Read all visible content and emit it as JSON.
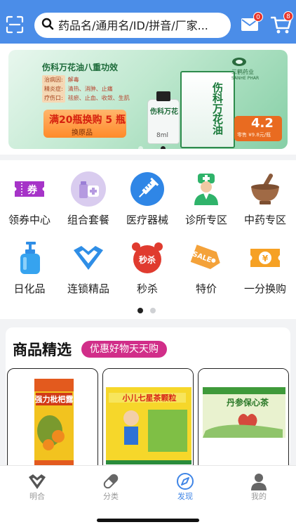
{
  "header": {
    "search_placeholder": "药品名/通用名/ID/拼音/厂家...",
    "message_badge": "0",
    "cart_badge": "8"
  },
  "banner": {
    "title": "伤科万花油八重功效",
    "lines": [
      {
        "tag": "治病因:",
        "text": "解毒"
      },
      {
        "tag": "精炎症:",
        "text": "清热、消肿、止痛"
      },
      {
        "tag": "疗伤口:",
        "text": "祛瘀、止血、收敛、生肌"
      }
    ],
    "offer_main": "满20瓶换购 5 瓶",
    "offer_sub": "换原品",
    "box_text": "伤科万花油",
    "bottle_label": "伤科万花",
    "bottle_ml": "8ml",
    "logo_text": "三鹤药业",
    "logo_sub": "SANHE PHAR",
    "price": "4.2",
    "price_sub": "零售 ¥9.8元/瓶",
    "slides": 2,
    "active_slide": 1
  },
  "categories": [
    {
      "label": "领券中心",
      "icon": "coupon-icon"
    },
    {
      "label": "组合套餐",
      "icon": "medicine-combo-icon"
    },
    {
      "label": "医疗器械",
      "icon": "syringe-icon"
    },
    {
      "label": "诊所专区",
      "icon": "doctor-icon"
    },
    {
      "label": "中药专区",
      "icon": "mortar-icon"
    },
    {
      "label": "日化品",
      "icon": "pump-bottle-icon"
    },
    {
      "label": "连锁精品",
      "icon": "chain-heart-icon"
    },
    {
      "label": "秒杀",
      "icon": "alarm-flash-sale-icon"
    },
    {
      "label": "特价",
      "icon": "sale-tag-icon"
    },
    {
      "label": "一分换购",
      "icon": "yuan-ticket-icon"
    }
  ],
  "categories_pager": {
    "pages": 2,
    "active": 0
  },
  "products": {
    "title": "商品精选",
    "tag": "优惠好物天天购",
    "items": [
      {
        "name": "强力枇杷露"
      },
      {
        "name": "小儿七星茶颗粒"
      },
      {
        "name": "丹参保心茶"
      }
    ]
  },
  "tabbar": [
    {
      "label": "明合",
      "icon": "heart-logo-icon",
      "active": false
    },
    {
      "label": "分类",
      "icon": "capsule-icon",
      "active": false
    },
    {
      "label": "发现",
      "icon": "compass-icon",
      "active": true
    },
    {
      "label": "我的",
      "icon": "user-icon",
      "active": false
    }
  ],
  "colors": {
    "header": "#4b8de8",
    "accent": "#3f85e6",
    "tag": "#d12e89",
    "badge": "#e8352b"
  }
}
